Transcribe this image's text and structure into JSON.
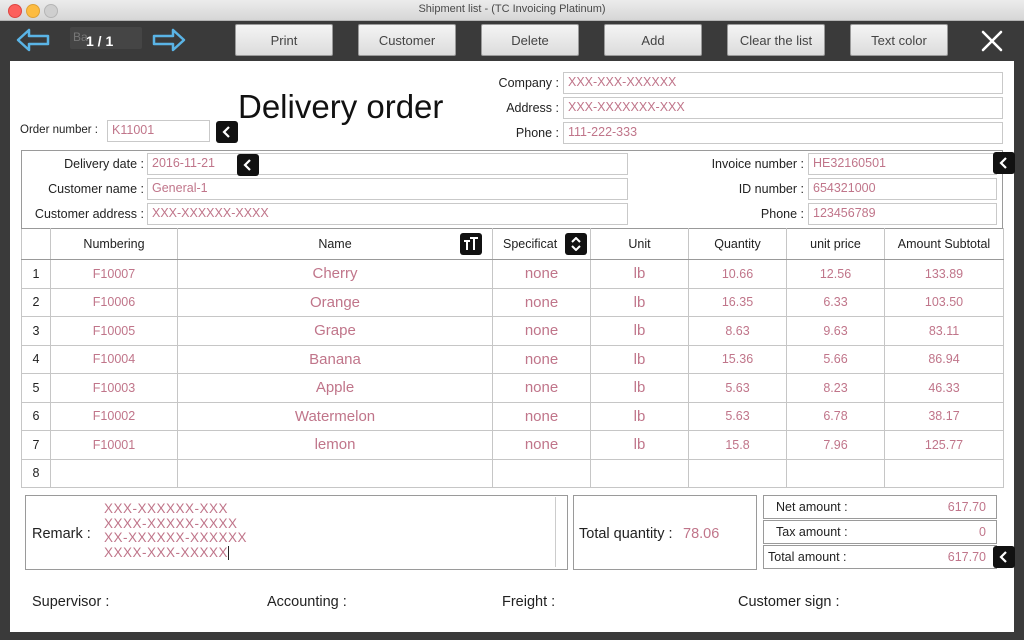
{
  "window": {
    "title": "Shipment list - (TC Invoicing Platinum)"
  },
  "toolbar": {
    "ghost_label": "Ba",
    "pager": "1 / 1",
    "buttons": [
      {
        "label": "Print"
      },
      {
        "label": "Customer"
      },
      {
        "label": "Delete"
      },
      {
        "label": "Add"
      },
      {
        "label": "Clear the list"
      },
      {
        "label": "Text color"
      }
    ]
  },
  "doc": {
    "title": "Delivery order",
    "order_number_label": "Order number :",
    "order_number": "K11001",
    "company_label": "Company :",
    "company": "XXX-XXX-XXXXXX",
    "address_label": "Address :",
    "address": "XXX-XXXXXXX-XXX",
    "phone_label": "Phone :",
    "phone": "111-222-333"
  },
  "customer": {
    "delivery_date_label": "Delivery date :",
    "delivery_date": "2016-11-21",
    "customer_name_label": "Customer name :",
    "customer_name": "General-1",
    "customer_address_label": "Customer address :",
    "customer_address": "XXX-XXXXXX-XXXX",
    "invoice_number_label": "Invoice number :",
    "invoice_number": "HE32160501",
    "id_number_label": "ID number :",
    "id_number": "654321000",
    "phone_label": "Phone :",
    "phone": "123456789"
  },
  "table": {
    "headers": [
      "Numbering",
      "Name",
      "Specificat",
      "Unit",
      "Quantity",
      "unit price",
      "Amount Subtotal"
    ],
    "rows": [
      {
        "n": "1",
        "numbering": "F10007",
        "name": "Cherry",
        "spec": "none",
        "unit": "lb",
        "qty": "10.66",
        "price": "12.56",
        "subtotal": "133.89"
      },
      {
        "n": "2",
        "numbering": "F10006",
        "name": "Orange",
        "spec": "none",
        "unit": "lb",
        "qty": "16.35",
        "price": "6.33",
        "subtotal": "103.50"
      },
      {
        "n": "3",
        "numbering": "F10005",
        "name": "Grape",
        "spec": "none",
        "unit": "lb",
        "qty": "8.63",
        "price": "9.63",
        "subtotal": "83.11"
      },
      {
        "n": "4",
        "numbering": "F10004",
        "name": "Banana",
        "spec": "none",
        "unit": "lb",
        "qty": "15.36",
        "price": "5.66",
        "subtotal": "86.94"
      },
      {
        "n": "5",
        "numbering": "F10003",
        "name": "Apple",
        "spec": "none",
        "unit": "lb",
        "qty": "5.63",
        "price": "8.23",
        "subtotal": "46.33"
      },
      {
        "n": "6",
        "numbering": "F10002",
        "name": "Watermelon",
        "spec": "none",
        "unit": "lb",
        "qty": "5.63",
        "price": "6.78",
        "subtotal": "38.17"
      },
      {
        "n": "7",
        "numbering": "F10001",
        "name": "lemon",
        "spec": "none",
        "unit": "lb",
        "qty": "15.8",
        "price": "7.96",
        "subtotal": "125.77"
      },
      {
        "n": "8",
        "numbering": "",
        "name": "",
        "spec": "",
        "unit": "",
        "qty": "",
        "price": "",
        "subtotal": ""
      }
    ]
  },
  "footer": {
    "remark_label": "Remark :",
    "remark_lines": [
      "XXX-XXXXXX-XXX",
      "XXXX-XXXXX-XXXX",
      "XX-XXXXXX-XXXXXX",
      "XXXX-XXX-XXXXX"
    ],
    "total_quantity_label": "Total quantity :",
    "total_quantity": "78.06",
    "net_amount_label": "Net amount :",
    "net_amount": "617.70",
    "tax_amount_label": "Tax amount :",
    "tax_amount": "0",
    "total_amount_label": "Total amount :",
    "total_amount": "617.70",
    "supervisor_label": "Supervisor :",
    "accounting_label": "Accounting :",
    "freight_label": "Freight :",
    "customer_sign_label": "Customer sign :"
  },
  "colors": {
    "value_text": "#c0758a",
    "toolbar_bg": "#3a3a3a",
    "arrow_accent": "#5ab4e6"
  }
}
